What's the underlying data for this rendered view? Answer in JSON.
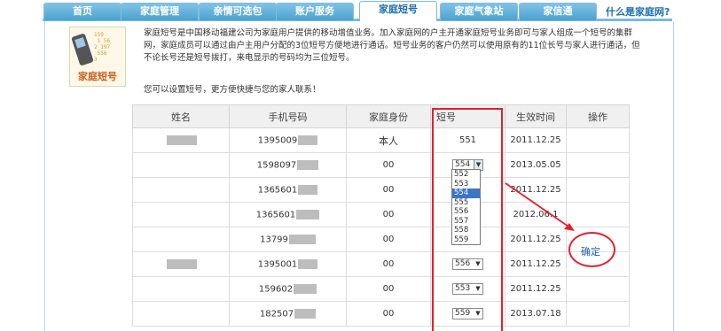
{
  "nav": {
    "tabs": [
      {
        "label": "首页"
      },
      {
        "label": "家庭管理"
      },
      {
        "label": "亲情可选包"
      },
      {
        "label": "账户服务"
      },
      {
        "label": "家庭短号"
      },
      {
        "label": "家庭气象站"
      },
      {
        "label": "家信通"
      }
    ],
    "help_link": "什么是家庭网?",
    "active_tab": "家庭短号"
  },
  "logo": {
    "caption": "家庭短号",
    "numbers": "159 1 56 2 197 556 3"
  },
  "intro": {
    "description": "家庭短号是中国移动福建公司为家庭用户提供的移动增值业务。加入家庭网的户主开通家庭短号业务即可与家人组成一个短号的集群网，家庭成员可以通过由户主用户分配的3位短号方便地进行通话。短号业务的客户仍然可以使用原有的11位长号与家人进行通话，但不论长号还是短号拨打，来电显示的号码均为三位短号。",
    "tip": "您可以设置短号，更方便快捷与您的家人联系！"
  },
  "table": {
    "headers": [
      "姓名",
      "手机号码",
      "家庭身份",
      "短号",
      "生效时间",
      "操作"
    ],
    "rows": [
      {
        "name_prefix": "",
        "phone": "1395009",
        "role": "本人",
        "short": "551",
        "date": "2011.12.25",
        "editable": false
      },
      {
        "name_prefix": "",
        "phone": "1598097",
        "role": "00",
        "short": "554",
        "date": "2013.05.05",
        "editable": true,
        "open": true
      },
      {
        "name_prefix": "",
        "phone": "1365601",
        "role": "00",
        "short": "",
        "date": "2011.12.25",
        "editable": true
      },
      {
        "name_prefix": "",
        "phone": "1365601",
        "role": "00",
        "short": "",
        "date": "2012.06.1",
        "editable": true
      },
      {
        "name_prefix": "",
        "phone": "13799",
        "role": "00",
        "short": "",
        "date": "2011.12.25",
        "editable": true
      },
      {
        "name_prefix": "",
        "phone": "1395001",
        "role": "00",
        "short": "556",
        "date": "2011.12.25",
        "editable": true
      },
      {
        "name_prefix": "",
        "phone": "159602",
        "role": "00",
        "short": "553",
        "date": "2011.12.25",
        "editable": true
      },
      {
        "name_prefix": "",
        "phone": "182507",
        "role": "00",
        "short": "559",
        "date": "2013.07.18",
        "editable": true
      }
    ]
  },
  "dropdown": {
    "options": [
      "552",
      "553",
      "554",
      "555",
      "556",
      "557",
      "558",
      "559"
    ],
    "highlighted": "554"
  },
  "annotation": {
    "confirm_label": "确定"
  },
  "colors": {
    "tab_blue": "#4aa2d0",
    "annotation_red": "#e4202e",
    "link_blue": "#1d6fb8"
  }
}
